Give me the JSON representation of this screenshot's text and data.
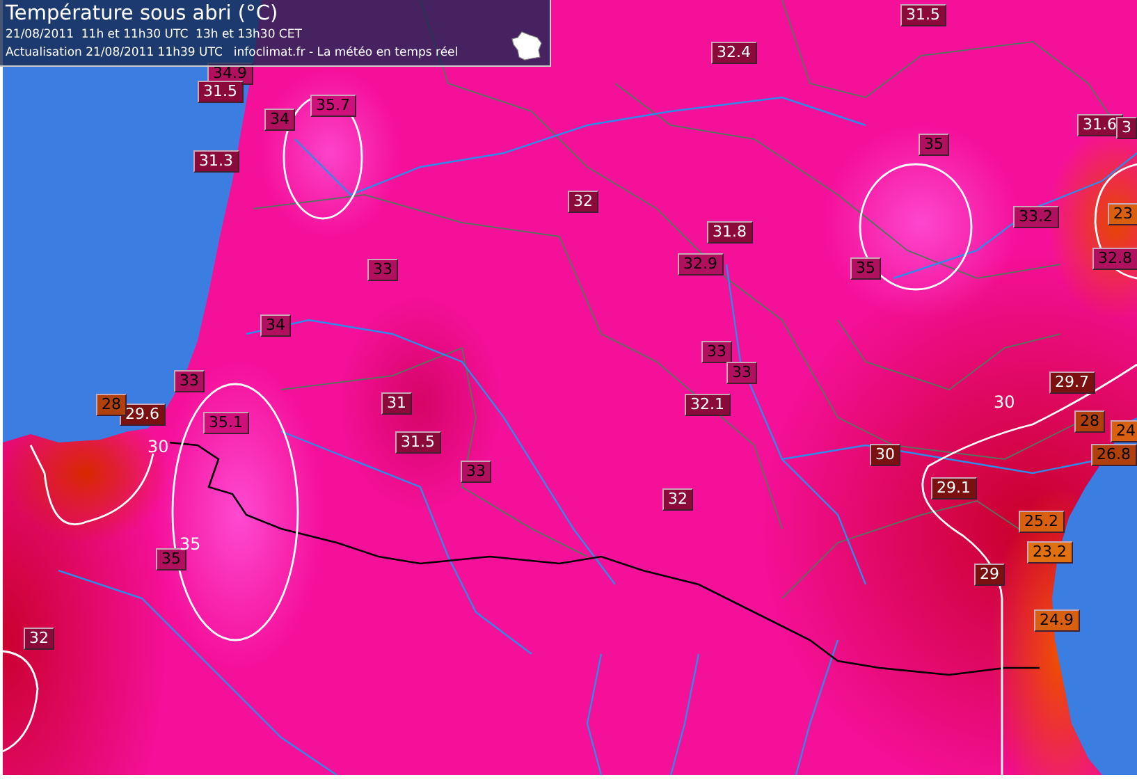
{
  "header": {
    "title": "Température sous abri (°C)",
    "line_1": "21/08/2011  11h et 11h30 UTC  13h et 13h30 CET",
    "update": "Actualisation 21/08/2011 11h39 UTC",
    "source": "infoclimat.fr - La météo en temps réel"
  },
  "stations": [
    {
      "value": "34.9",
      "color": "#b0105e"
    },
    {
      "value": "31.5",
      "color": "#8b0a3a"
    },
    {
      "value": "35.7",
      "color": "#d0107a"
    },
    {
      "value": "34",
      "color": "#b0105e"
    },
    {
      "value": "31.3",
      "color": "#8b0a3a"
    },
    {
      "value": "32.4",
      "color": "#8b0a3a"
    },
    {
      "value": "31.5",
      "color": "#8b0a3a"
    },
    {
      "value": "31.6",
      "color": "#8b0a3a"
    },
    {
      "value": "3",
      "color": "#8b0a3a"
    },
    {
      "value": "32",
      "color": "#8b0a3a"
    },
    {
      "value": "35",
      "color": "#b0105e"
    },
    {
      "value": "33.2",
      "color": "#b0105e"
    },
    {
      "value": "23",
      "color": "#d86010"
    },
    {
      "value": "31.8",
      "color": "#8b0a3a"
    },
    {
      "value": "32.9",
      "color": "#b0105e"
    },
    {
      "value": "35",
      "color": "#b0105e"
    },
    {
      "value": "32.8",
      "color": "#b0105e"
    },
    {
      "value": "33",
      "color": "#b0105e"
    },
    {
      "value": "34",
      "color": "#b0105e"
    },
    {
      "value": "33",
      "color": "#b0105e"
    },
    {
      "value": "33",
      "color": "#b0105e"
    },
    {
      "value": "33",
      "color": "#b0105e"
    },
    {
      "value": "29.7",
      "color": "#7a1010"
    },
    {
      "value": "28",
      "color": "#b0400c"
    },
    {
      "value": "29.6",
      "color": "#7a1010"
    },
    {
      "value": "31",
      "color": "#8b0a3a"
    },
    {
      "value": "32.1",
      "color": "#8b0a3a"
    },
    {
      "value": "35.1",
      "color": "#d0107a"
    },
    {
      "value": "28",
      "color": "#b0400c"
    },
    {
      "value": "24",
      "color": "#d86010"
    },
    {
      "value": "31.5",
      "color": "#8b0a3a"
    },
    {
      "value": "30",
      "color": "#7a1010"
    },
    {
      "value": "26.8",
      "color": "#b0400c"
    },
    {
      "value": "33",
      "color": "#b0105e"
    },
    {
      "value": "29.1",
      "color": "#7a1010"
    },
    {
      "value": "32",
      "color": "#8b0a3a"
    },
    {
      "value": "25.2",
      "color": "#d86010"
    },
    {
      "value": "23.2",
      "color": "#e07010"
    },
    {
      "value": "35",
      "color": "#b0105e"
    },
    {
      "value": "29",
      "color": "#7a1010"
    },
    {
      "value": "24.9",
      "color": "#d86010"
    },
    {
      "value": "32",
      "color": "#8b0a3a"
    }
  ],
  "isolines": [
    {
      "label": "30"
    },
    {
      "label": "35"
    },
    {
      "label": "30"
    }
  ]
}
